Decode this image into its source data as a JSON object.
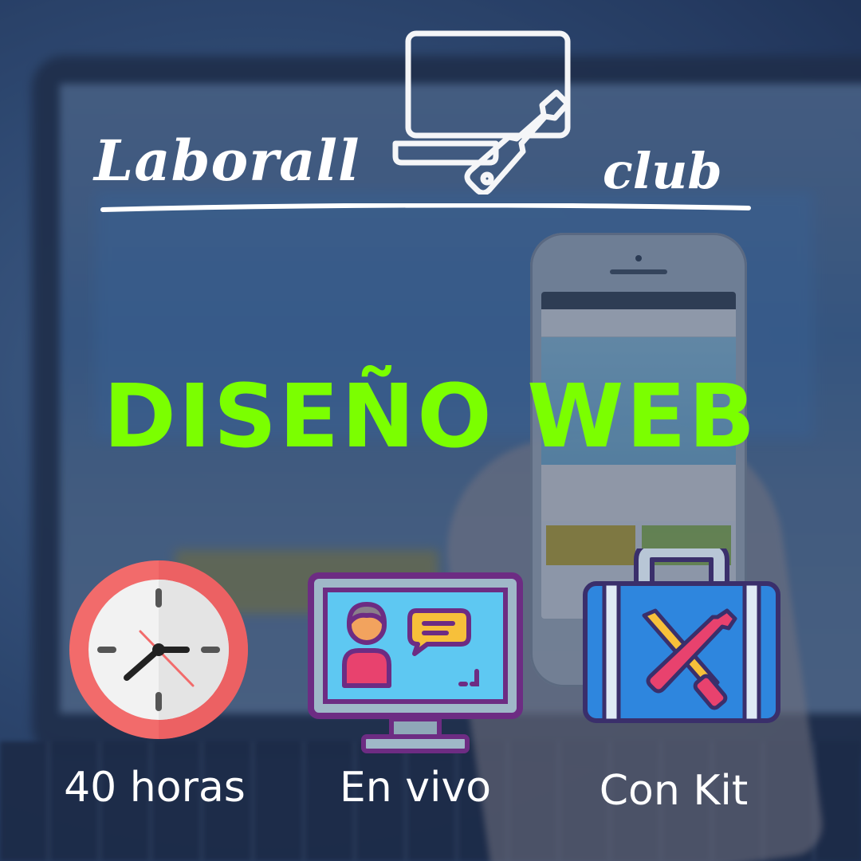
{
  "logo": {
    "left_word": "Laborall",
    "right_word": "club",
    "emblem_icon": "laptop-wrench-icon"
  },
  "title": "DISEÑO WEB",
  "features": [
    {
      "icon": "clock-icon",
      "label": "40 horas"
    },
    {
      "icon": "video-call-monitor-icon",
      "label": "En vivo"
    },
    {
      "icon": "toolbox-icon",
      "label": "Con Kit"
    }
  ],
  "colors": {
    "title": "#7bff00",
    "text": "#ffffff",
    "clock_ring": "#f06b6b",
    "monitor_frame": "#6d2c83",
    "monitor_screen": "#5ec8f2",
    "toolbox_body": "#2e86de"
  }
}
